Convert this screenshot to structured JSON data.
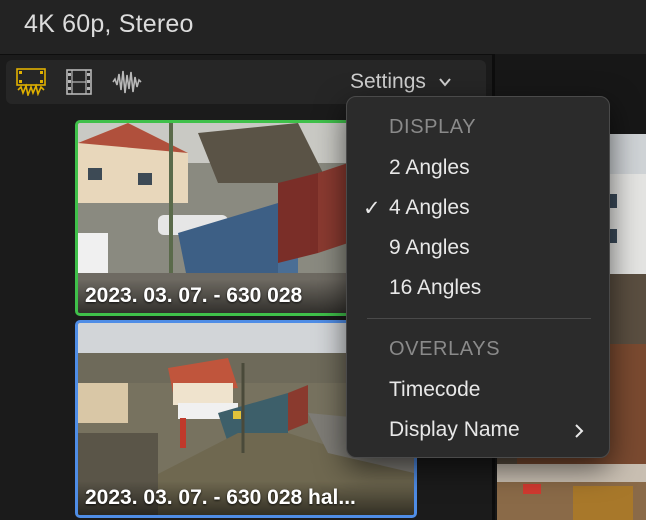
{
  "header": {
    "format_label": "4K 60p, Stereo"
  },
  "toolbar": {
    "icons": [
      "video-audio-icon",
      "video-only-icon",
      "audio-only-icon"
    ],
    "settings_label": "Settings",
    "accent": "#e0b000"
  },
  "angles": [
    {
      "caption": "2023. 03. 07. - 630 028",
      "border_color": "#3fc04a"
    },
    {
      "caption": "2023. 03. 07. - 630 028 hal...",
      "border_color": "#4f8de6"
    }
  ],
  "menu": {
    "display_header": "DISPLAY",
    "display_items": [
      {
        "label": "2 Angles",
        "checked": false
      },
      {
        "label": "4 Angles",
        "checked": true
      },
      {
        "label": "9 Angles",
        "checked": false
      },
      {
        "label": "16 Angles",
        "checked": false
      }
    ],
    "check_glyph": "✓",
    "overlays_header": "OVERLAYS",
    "overlay_items": [
      {
        "label": "Timecode",
        "has_submenu": false
      },
      {
        "label": "Display Name",
        "has_submenu": true
      }
    ]
  }
}
